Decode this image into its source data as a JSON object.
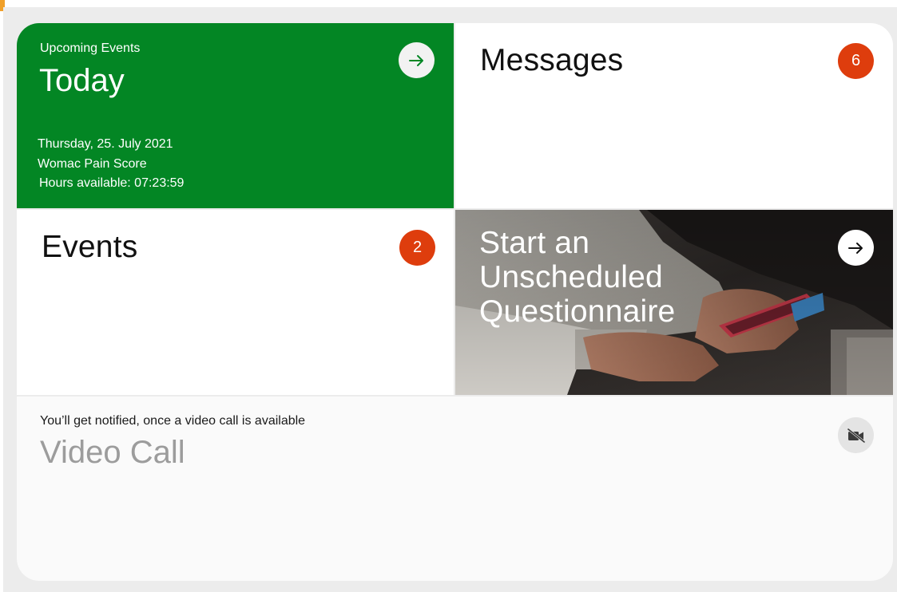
{
  "today_card": {
    "eyebrow": "Upcoming Events",
    "title": "Today",
    "date": "Thursday, 25. July 2021",
    "event_name": "Womac Pain Score",
    "hours_available": "Hours available: 07:23:59",
    "arrow_icon": "arrow-right-icon"
  },
  "messages_card": {
    "title": "Messages",
    "count": "6"
  },
  "events_card": {
    "title": "Events",
    "count": "2"
  },
  "questionnaire_card": {
    "title": "Start an Unscheduled Questionnaire",
    "arrow_icon": "arrow-right-icon"
  },
  "video_card": {
    "notice": "You’ll get notified, once a video call is available",
    "title": "Video Call",
    "icon": "video-off-icon"
  },
  "colors": {
    "today_green": "#038624",
    "badge_red": "#de3d0d",
    "disabled_gray": "#9c9c9c",
    "background_gray": "#ececec"
  }
}
